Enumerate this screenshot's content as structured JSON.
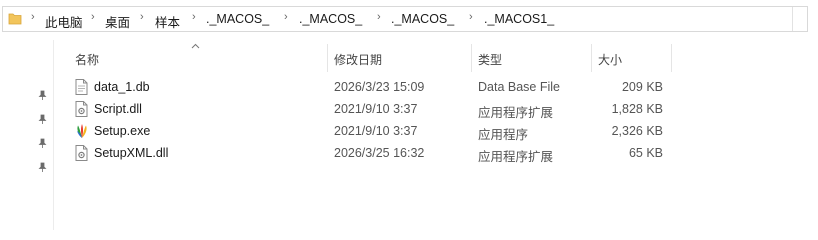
{
  "breadcrumb": [
    "此电脑",
    "桌面",
    "样本",
    "._MACOS_",
    "._MACOS_",
    "._MACOS_",
    "._MACOS1_"
  ],
  "columns": {
    "name": "名称",
    "modified": "修改日期",
    "type": "类型",
    "size": "大小"
  },
  "files": [
    {
      "name": "data_1.db",
      "modified": "2026/3/23 15:09",
      "type": "Data Base File",
      "size": "209 KB",
      "icon": "db-file-icon"
    },
    {
      "name": "Script.dll",
      "modified": "2021/9/10 3:37",
      "type": "应用程序扩展",
      "size": "1,828 KB",
      "icon": "dll-file-icon"
    },
    {
      "name": "Setup.exe",
      "modified": "2021/9/10 3:37",
      "type": "应用程序",
      "size": "2,326 KB",
      "icon": "exe-app-icon"
    },
    {
      "name": "SetupXML.dll",
      "modified": "2026/3/25 16:32",
      "type": "应用程序扩展",
      "size": "65 KB",
      "icon": "dll-file-icon"
    }
  ],
  "colors": {
    "folder": "#f2c55c",
    "border": "#d9d9d9",
    "text_secondary": "#555555"
  }
}
